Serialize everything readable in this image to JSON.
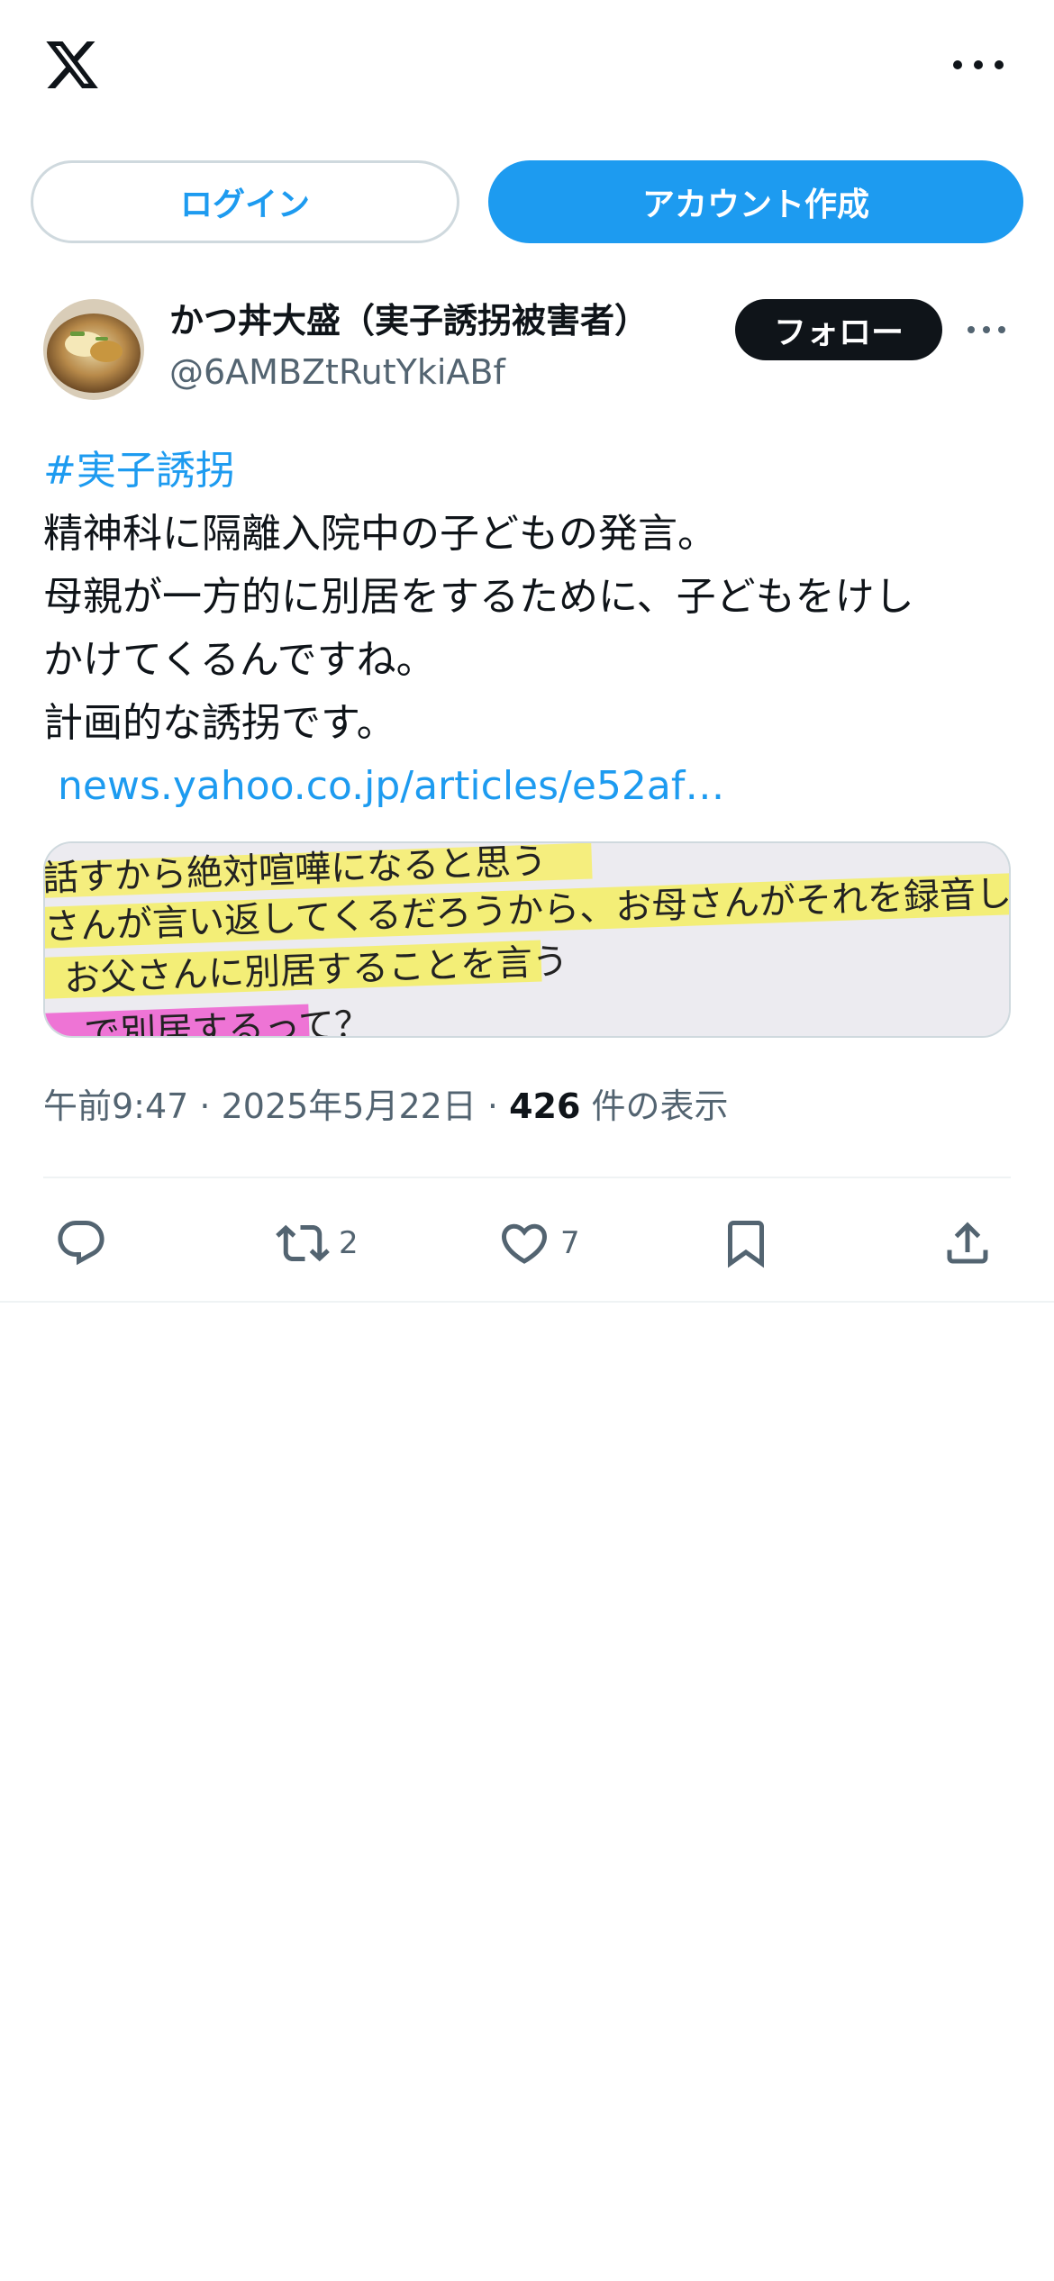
{
  "header": {
    "logo_icon": "x-logo-icon",
    "more_icon": "more-horizontal-icon"
  },
  "auth": {
    "login_label": "ログイン",
    "signup_label": "アカウント作成"
  },
  "tweet": {
    "author": {
      "display_name": "かつ丼大盛（実子誘拐被害者）",
      "handle": "@6AMBZtRutYkiABf",
      "follow_label": "フォロー",
      "avatar_icon": "avatar-katsudon-image"
    },
    "hashtag": "#実子誘拐",
    "lines": [
      "精神科に隔離入院中の子どもの発言。",
      "母親が一方的に別居をするために、子どもをけし",
      "かけてくるんですね。",
      "計画的な誘拐です。"
    ],
    "link_text": "news.yahoo.co.jp/articles/e52af…",
    "media": {
      "lines": [
        "話すから絶対喧嘩になると思う",
        "さんが言い返してくるだろうから、お母さんがそれを録音し",
        "お父さんに別居することを言う",
        "で別居するって？"
      ]
    },
    "meta": {
      "time": "午前9:47",
      "separator": " · ",
      "date": "2025年5月22日",
      "views_count": "426",
      "views_label": " 件の表示"
    },
    "actions": {
      "reply_count": "",
      "retweet_count": "2",
      "like_count": "7"
    }
  },
  "colors": {
    "accent": "#1d9bf0",
    "text": "#0f1419",
    "secondary": "#536471",
    "border": "#cfd9de"
  }
}
